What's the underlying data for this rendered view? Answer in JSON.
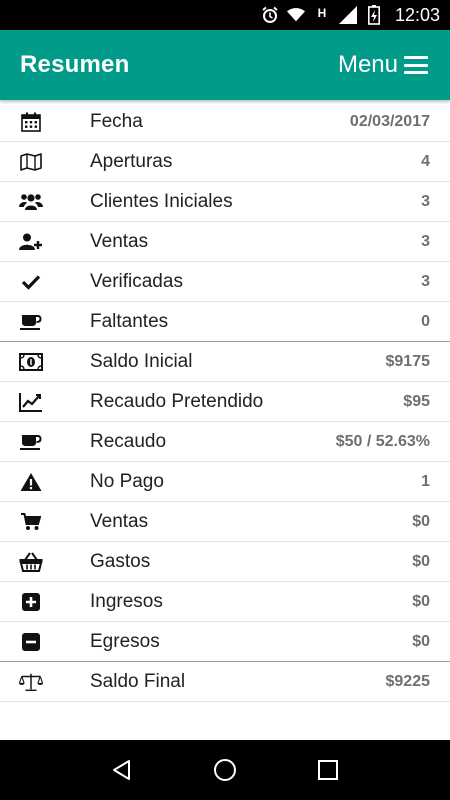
{
  "status_bar": {
    "time": "12:03",
    "icons": [
      "alarm-icon",
      "wifi-icon",
      "h-network-icon",
      "signal-icon",
      "battery-icon"
    ],
    "network_letter": "H"
  },
  "app_bar": {
    "title": "Resumen",
    "menu_label": "Menu",
    "color": "#009c89"
  },
  "rows": [
    {
      "icon": "calendar-icon",
      "label": "Fecha",
      "value": "02/03/2017"
    },
    {
      "icon": "map-icon",
      "label": "Aperturas",
      "value": "4"
    },
    {
      "icon": "users-icon",
      "label": "Clientes Iniciales",
      "value": "3"
    },
    {
      "icon": "user-plus-icon",
      "label": "Ventas",
      "value": "3"
    },
    {
      "icon": "check-icon",
      "label": "Verificadas",
      "value": "3"
    },
    {
      "icon": "coffee-icon",
      "label": "Faltantes",
      "value": "0"
    },
    {
      "icon": "money-icon",
      "label": "Saldo Inicial",
      "value": "$9175"
    },
    {
      "icon": "line-chart-icon",
      "label": "Recaudo Pretendido",
      "value": "$95"
    },
    {
      "icon": "coffee-icon",
      "label": "Recaudo",
      "value": "$50 / 52.63%"
    },
    {
      "icon": "warning-icon",
      "label": "No Pago",
      "value": "1"
    },
    {
      "icon": "cart-icon",
      "label": "Ventas",
      "value": "$0"
    },
    {
      "icon": "basket-icon",
      "label": "Gastos",
      "value": "$0"
    },
    {
      "icon": "plus-square-icon",
      "label": "Ingresos",
      "value": "$0"
    },
    {
      "icon": "minus-square-icon",
      "label": "Egresos",
      "value": "$0"
    },
    {
      "icon": "balance-scale-icon",
      "label": "Saldo Final",
      "value": "$9225"
    }
  ],
  "nav_bar": {
    "icons": [
      "back-icon",
      "home-icon",
      "recents-icon"
    ]
  }
}
